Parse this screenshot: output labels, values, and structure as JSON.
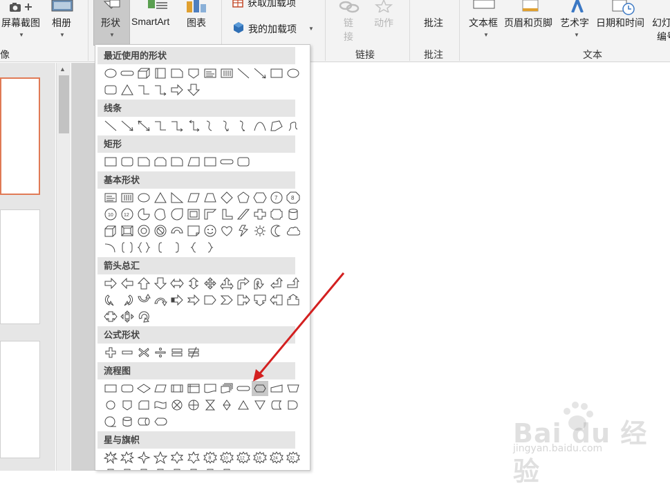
{
  "ribbon": {
    "screenshot_label": "屏幕截图",
    "album_label": "相册",
    "image_group_label": "像",
    "shapes_label": "形状",
    "smartart_label": "SmartArt",
    "chart_label": "图表",
    "get_addins_label": "获取加载项",
    "my_addins_label": "我的加载项",
    "link_label": "链接",
    "link_label_vertical": [
      "链",
      "接"
    ],
    "action_label": "动作",
    "links_group_label": "链接",
    "comment_label": "批注",
    "comments_group_label": "批注",
    "textbox_label": "文本框",
    "header_footer_label": "页眉和页脚",
    "wordart_label": "艺术字",
    "datetime_label": "日期和时间",
    "slide_number_label": "幻灯",
    "slide_number_label_2": "编号",
    "text_group_label": "文本"
  },
  "gallery": {
    "categories": [
      {
        "key": "recent",
        "label": "最近使用的形状"
      },
      {
        "key": "lines",
        "label": "线条"
      },
      {
        "key": "rect",
        "label": "矩形"
      },
      {
        "key": "basic",
        "label": "基本形状"
      },
      {
        "key": "arrows",
        "label": "箭头总汇"
      },
      {
        "key": "equation",
        "label": "公式形状"
      },
      {
        "key": "flowchart",
        "label": "流程图"
      },
      {
        "key": "stars",
        "label": "星与旗帜"
      }
    ],
    "selected_shape": "flowchart-preparation-shape"
  },
  "watermark": {
    "brand": "Bai du 经验",
    "url": "jingyan.baidu.com"
  },
  "colors": {
    "accent_slide_border": "#e07a55",
    "annotation_arrow": "#d32020"
  }
}
